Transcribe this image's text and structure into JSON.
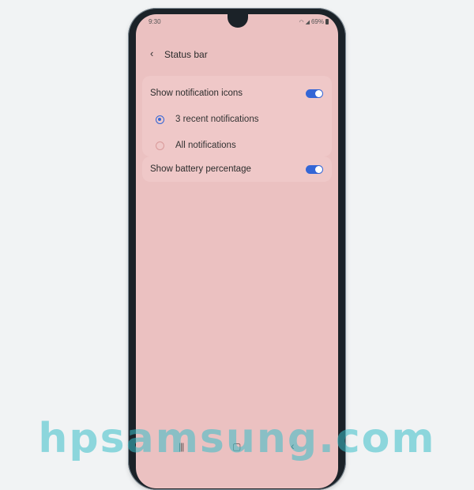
{
  "status_bar": {
    "time": "9:30",
    "battery": "69%"
  },
  "header": {
    "title": "Status bar"
  },
  "settings": {
    "show_notification_icons": {
      "label": "Show notification icons",
      "enabled": true
    },
    "options": [
      {
        "label": "3 recent notifications",
        "selected": true
      },
      {
        "label": "All notifications",
        "selected": false
      }
    ],
    "show_battery_percentage": {
      "label": "Show battery percentage",
      "enabled": true
    }
  },
  "navbar": {
    "recent_icon": "recents-icon",
    "home_icon": "home-icon",
    "back_icon": "back-icon"
  },
  "watermark": "hpsamsung.com",
  "colors": {
    "accent": "#3466d6",
    "background": "#ebc1c1"
  }
}
